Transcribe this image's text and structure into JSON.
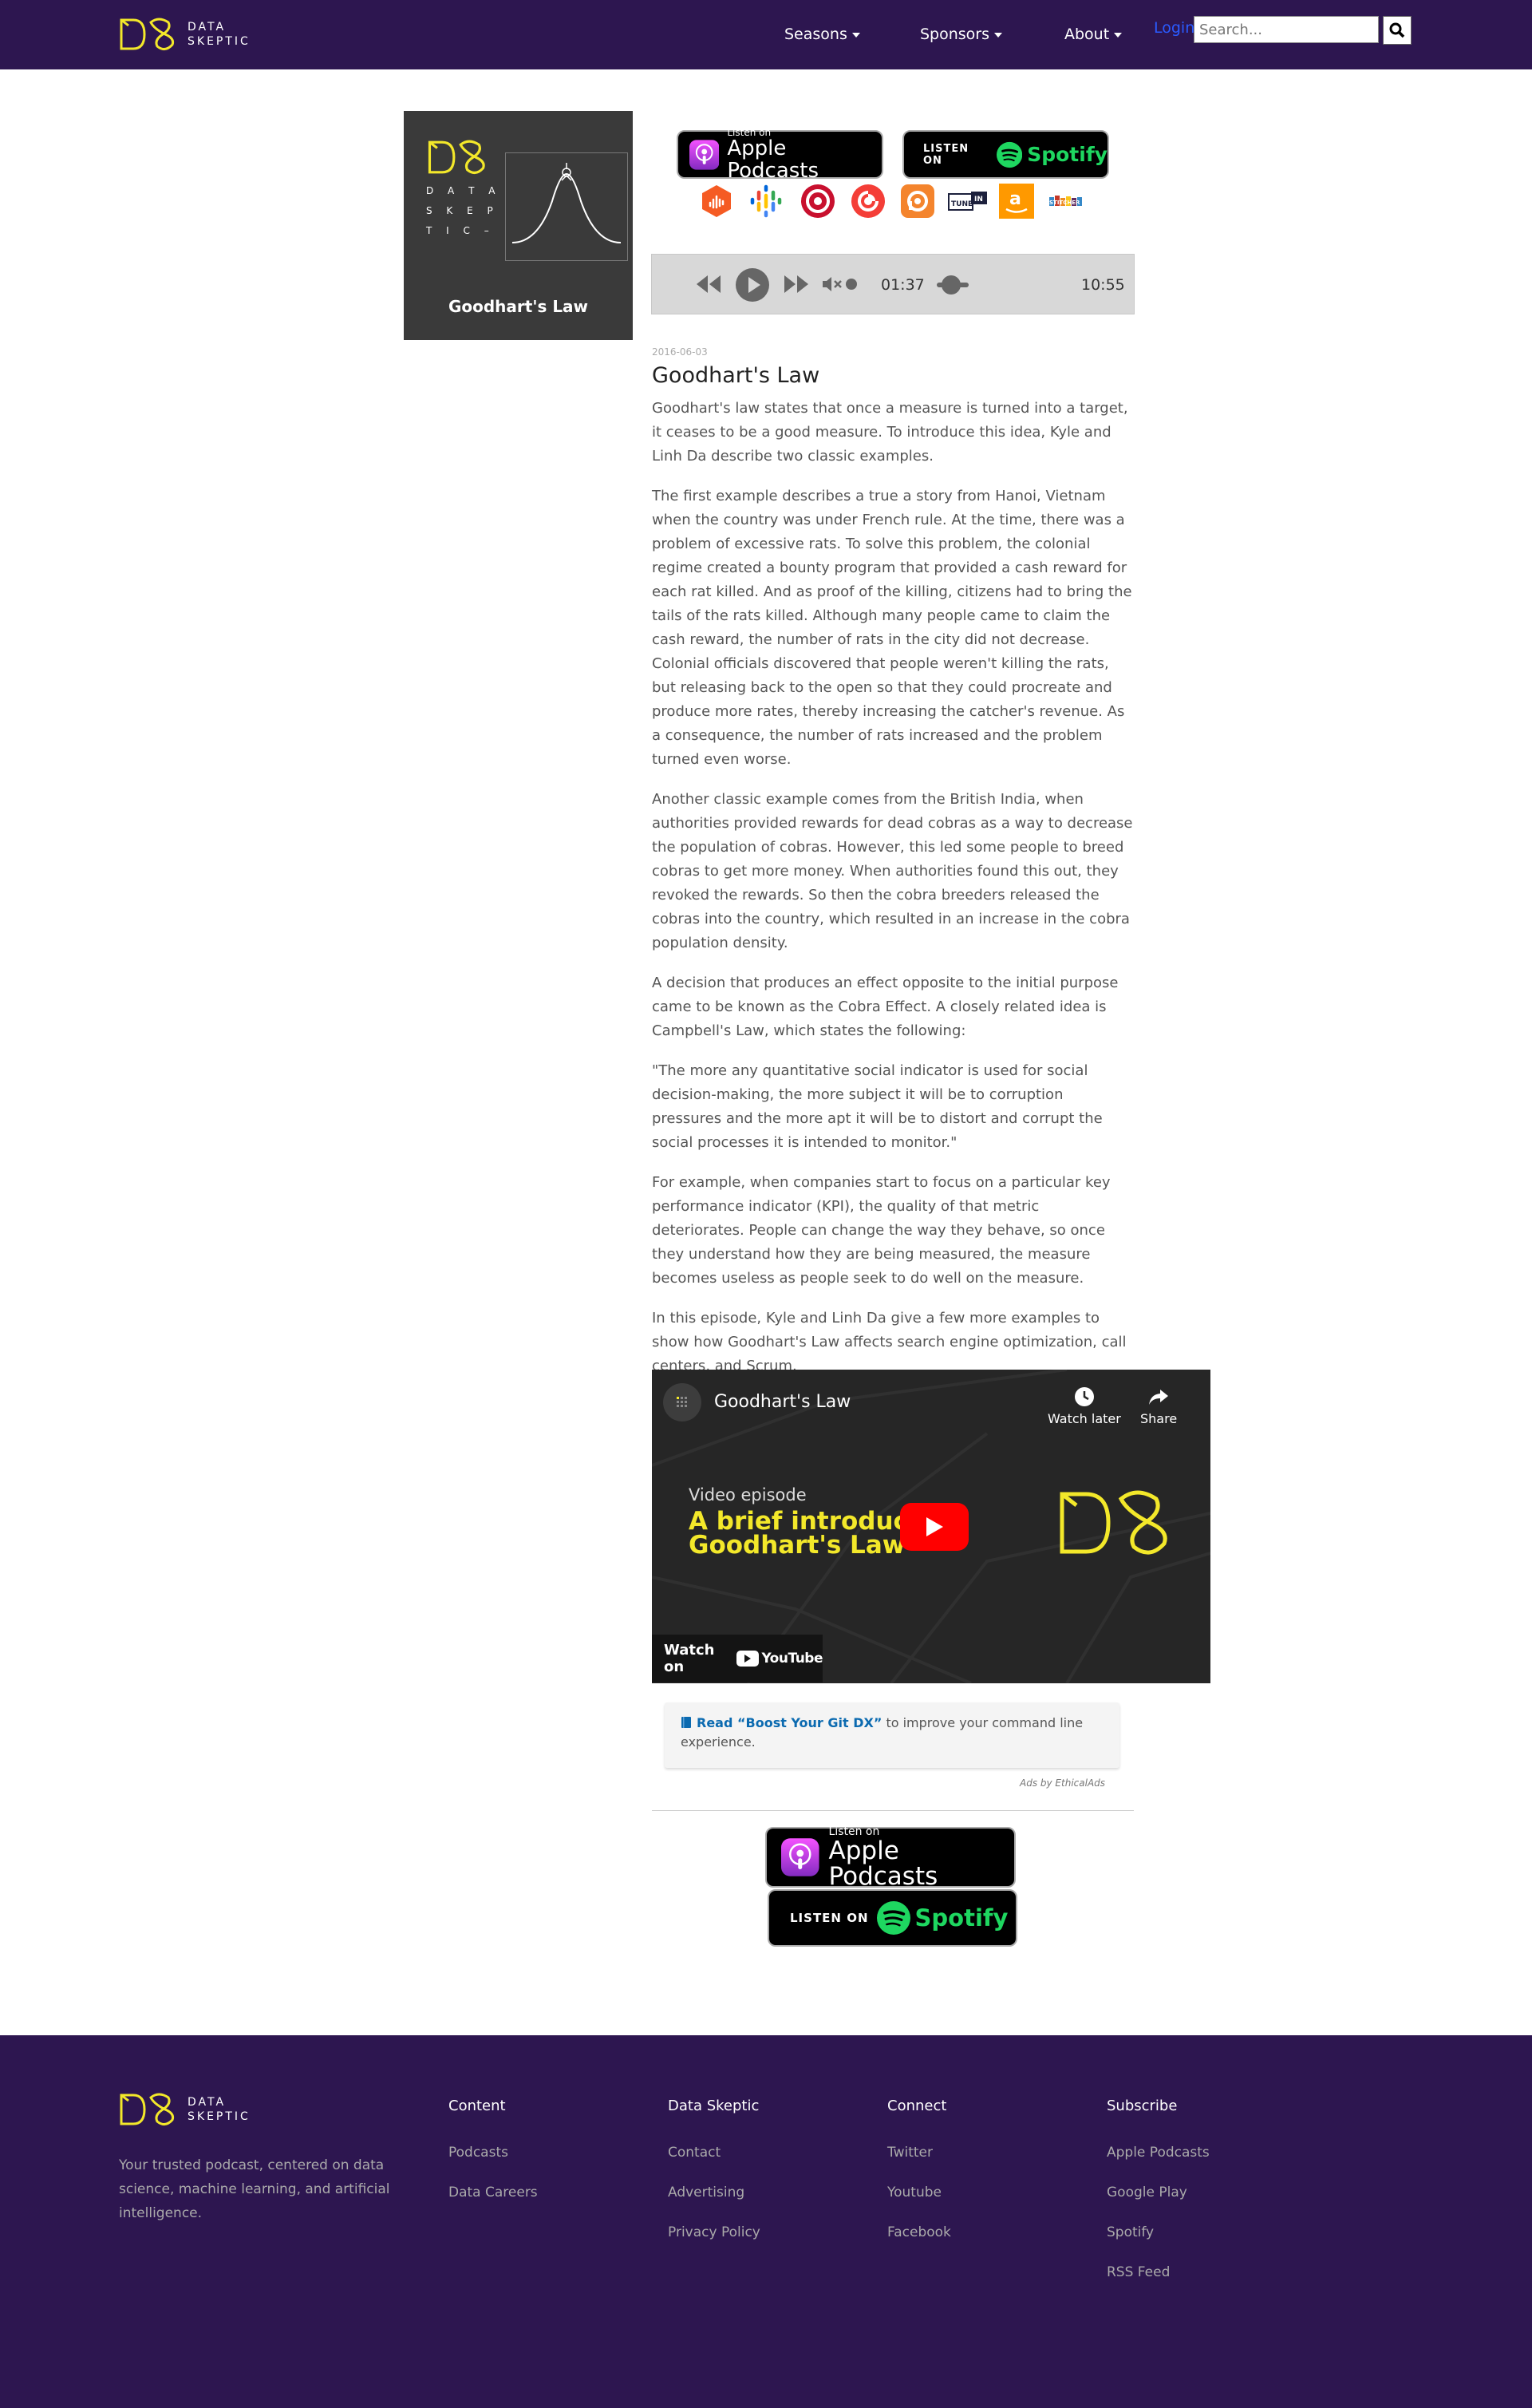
{
  "header": {
    "logo_line1": "DATA",
    "logo_line2": "SKEPTIC",
    "nav": {
      "seasons": "Seasons",
      "sponsors": "Sponsors",
      "about": "About"
    },
    "login": "Login",
    "search_placeholder": "Search..."
  },
  "episode": {
    "cover": {
      "title": "Goodhart's Law",
      "ds_letters": [
        "D A T A",
        "S K E P",
        "T I C –"
      ]
    },
    "apple_badge": {
      "small": "Listen on",
      "big": "Apple Podcasts"
    },
    "spotify_badge": {
      "small": "LISTEN ON",
      "big": "Spotify"
    },
    "platform_icons": [
      "castbox-icon",
      "google-podcasts-icon",
      "player-fm-icon",
      "pocket-casts-icon",
      "podcast-addict-icon",
      "tunein-icon",
      "amazon-music-icon",
      "stitcher-icon"
    ],
    "player": {
      "current_time": "01:37",
      "duration": "10:55",
      "progress": 0.148
    },
    "date": "2016-06-03",
    "title": "Goodhart's Law",
    "paragraphs": [
      "Goodhart's law states that once a measure is turned into a target, it ceases to be a good measure. To introduce this idea, Kyle and Linh Da describe two classic examples.",
      "The first example describes a true a story from Hanoi, Vietnam when the country was under French rule. At the time, there was a problem of excessive rats. To solve this problem, the colonial regime created a bounty program that provided a cash reward for each rat killed. And as proof of the killing, citizens had to bring the tails of the rats killed. Although many people came to claim the cash reward, the number of rats in the city did not decrease. Colonial officials discovered that people weren't killing the rats, but releasing back to the open so that they could procreate and produce more rates, thereby increasing the catcher's revenue. As a consequence, the number of rats increased and the problem turned even worse.",
      "Another classic example comes from the British India, when authorities provided rewards for dead cobras as a way to decrease the population of cobras. However, this led some people to breed cobras to get more money. When authorities found this out, they revoked the rewards. So then the cobra breeders released the cobras into the country, which resulted in an increase in the cobra population density.",
      "A decision that produces an effect opposite to the initial purpose came to be known as the Cobra Effect. A closely related idea is Campbell's Law, which states the following:",
      "\"The more any quantitative social indicator is used for social decision-making, the more subject it will be to corruption pressures and the more apt it will be to distort and corrupt the social processes it is intended to monitor.\"",
      "For example, when companies start to focus on a particular key performance indicator (KPI), the quality of that metric deteriorates. People can change the way they behave, so once they understand how they are being measured, the measure becomes useless as people seek to do well on the measure.",
      "In this episode, Kyle and Linh Da give a few more examples to show how Goodhart's Law affects search engine optimization, call centers, and Scrum."
    ],
    "video": {
      "title": "Goodhart's Law",
      "watch_later": "Watch later",
      "share": "Share",
      "subtitle": "Video episode",
      "headline_1": "A brief introductio",
      "headline_2": "Goodhart's Law",
      "watch_on": "Watch on",
      "youtube": "YouTube"
    },
    "ad": {
      "link_text": "Read “Boost Your Git DX”",
      "rest_text": " to improve your command line experience.",
      "ads_by": "Ads by EthicalAds"
    }
  },
  "footer": {
    "tagline": "Your trusted podcast, centered on data science, machine learning, and artificial intelligence.",
    "columns": [
      {
        "title": "Content",
        "links": [
          "Podcasts",
          "Data Careers"
        ]
      },
      {
        "title": "Data Skeptic",
        "links": [
          "Contact",
          "Advertising",
          "Privacy Policy"
        ]
      },
      {
        "title": "Connect",
        "links": [
          "Twitter",
          "Youtube",
          "Facebook"
        ]
      },
      {
        "title": "Subscribe",
        "links": [
          "Apple Podcasts",
          "Google Play",
          "Spotify",
          "RSS Feed"
        ]
      }
    ]
  },
  "colors": {
    "brand_purple": "#2d1650",
    "logo_yellow": "#f3e82a",
    "spotify_green": "#1ed760",
    "youtube_red": "#ff0000",
    "login_blue": "#2a5bff"
  }
}
